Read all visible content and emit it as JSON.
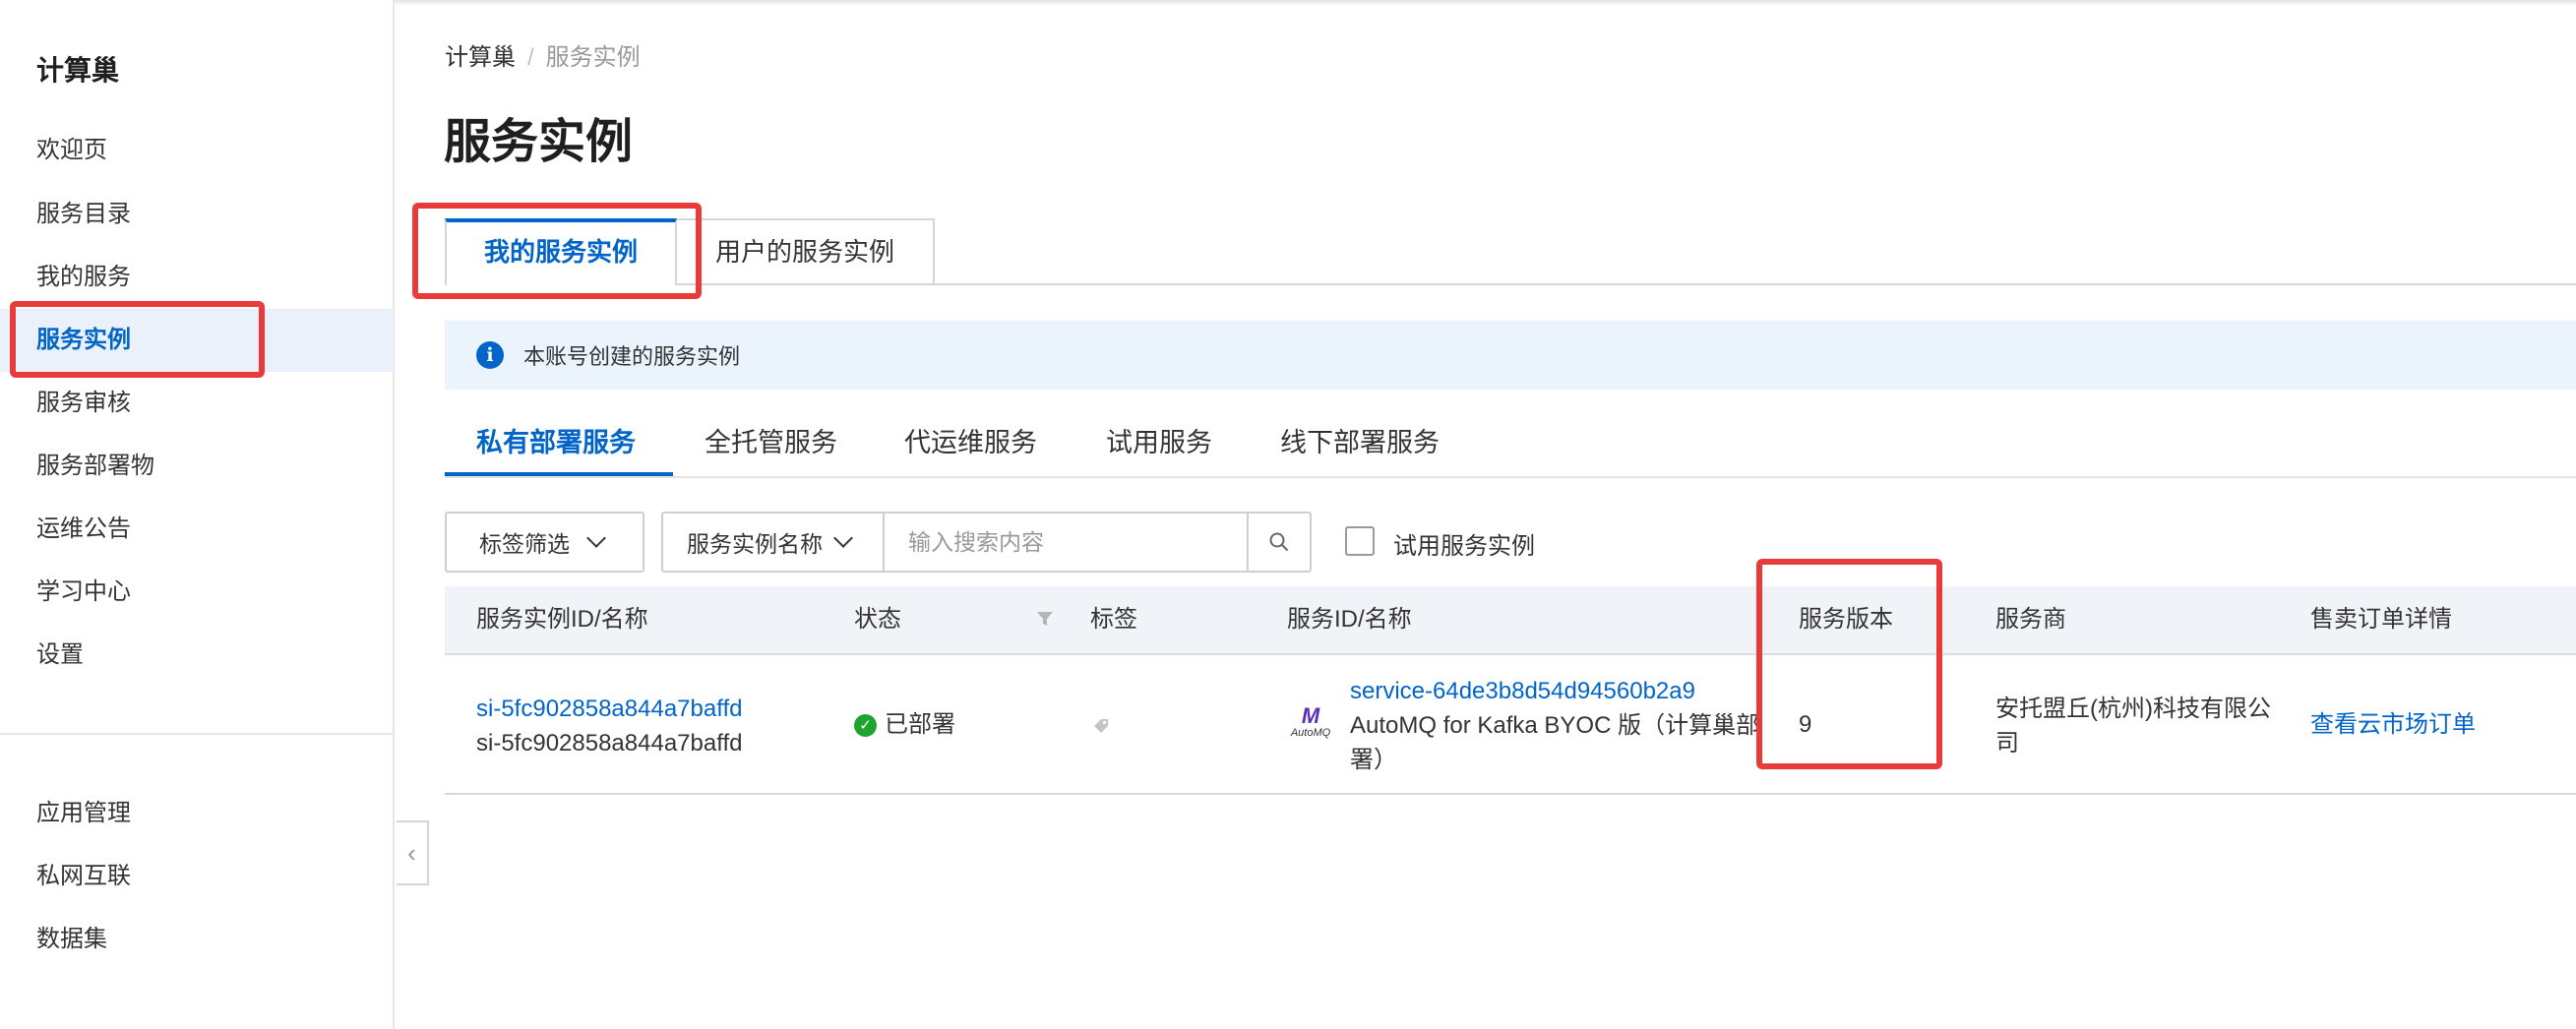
{
  "sidebar": {
    "title": "计算巢",
    "items": [
      {
        "label": "欢迎页"
      },
      {
        "label": "服务目录"
      },
      {
        "label": "我的服务"
      },
      {
        "label": "服务实例"
      },
      {
        "label": "服务审核"
      },
      {
        "label": "服务部署物"
      },
      {
        "label": "运维公告"
      },
      {
        "label": "学习中心"
      },
      {
        "label": "设置"
      }
    ],
    "bottom_items": [
      {
        "label": "应用管理"
      },
      {
        "label": "私网互联"
      },
      {
        "label": "数据集"
      }
    ]
  },
  "breadcrumb": {
    "root": "计算巢",
    "separator": "/",
    "current": "服务实例"
  },
  "page_title": "服务实例",
  "tabs": [
    {
      "label": "我的服务实例",
      "active": true
    },
    {
      "label": "用户的服务实例",
      "active": false
    }
  ],
  "notice": {
    "text": "本账号创建的服务实例",
    "icon": "info-icon"
  },
  "subtabs": [
    {
      "label": "私有部署服务",
      "active": true
    },
    {
      "label": "全托管服务"
    },
    {
      "label": "代运维服务"
    },
    {
      "label": "试用服务"
    },
    {
      "label": "线下部署服务"
    }
  ],
  "filters": {
    "tag_filter": "标签筛选",
    "search_field": "服务实例名称",
    "search_placeholder": "输入搜索内容",
    "trial_checkbox_label": "试用服务实例"
  },
  "table": {
    "columns": [
      "服务实例ID/名称",
      "状态",
      "标签",
      "服务ID/名称",
      "服务版本",
      "服务商",
      "售卖订单详情"
    ],
    "rows": [
      {
        "instance_id": "si-5fc902858a844a7baffd",
        "instance_name": "si-5fc902858a844a7baffd",
        "status": "已部署",
        "service_id": "service-64de3b8d54d94560b2a9",
        "service_name_line1": "AutoMQ for Kafka BYOC 版（计算巢部",
        "service_name_line2": "署）",
        "logo_mark": "M",
        "logo_text": "AutoMQ",
        "version": "9",
        "provider_line1": "安托盟丘(杭州)科技有限公",
        "provider_line2": "司",
        "order_link": "查看云市场订单"
      }
    ]
  },
  "colors": {
    "accent": "#0064c8",
    "annotation": "#ea3b3b",
    "status_ok": "#1fa32f"
  }
}
